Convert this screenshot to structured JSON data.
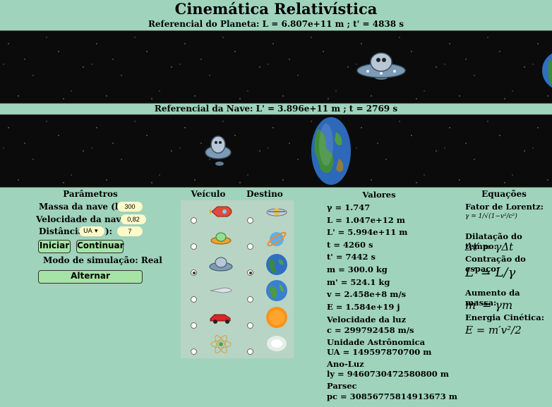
{
  "header": {
    "title": "Cinemática Relativística",
    "planet_frame": "Referencial do Planeta: L = 6.807e+11 m ; t' = 4838 s",
    "ship_frame": "Referencial da Nave: L' = 3.896e+11 m ; t = 2769 s"
  },
  "params": {
    "heading": "Parâmetros",
    "mass_label": "Massa da nave (kg):",
    "mass_value": "300",
    "speed_label": "Velocidade da nave (c):",
    "speed_value": "0,82",
    "distance_label_pre": "Distância (",
    "distance_unit": "UA",
    "distance_label_post": "):",
    "distance_value": "7",
    "start_button": "Iniciar",
    "continue_button": "Continuar",
    "mode_text": "Modo de simulação: Real",
    "toggle_button": "Alternar"
  },
  "selection": {
    "vehicle_heading": "Veículo",
    "destination_heading": "Destino",
    "vehicles": [
      "rocket-icon",
      "ufo-icon",
      "flying-saucer-icon",
      "spaceplane-icon",
      "race-car-icon",
      "atom-icon"
    ],
    "destinations": [
      "space-station-icon",
      "planet-icon",
      "earth-icon",
      "earth-globe-icon",
      "sun-icon",
      "nebula-icon"
    ],
    "selected_vehicle_index": 2,
    "selected_destination_index": 2
  },
  "values": {
    "heading": "Valores",
    "lines": [
      "γ = 1.747",
      "L = 1.047e+12 m",
      "L' = 5.994e+11 m",
      "t = 4260 s",
      "t' = 7442 s",
      "m = 300.0 kg",
      "m' = 524.1 kg",
      "v = 2.458e+8 m/s",
      "E = 1.584e+19 j"
    ],
    "light_title": "Velocidade da luz",
    "light_value": "c = 299792458 m/s",
    "au_title": "Unidade Astrônomica",
    "au_value": "UA = 149597870700 m",
    "ly_title": "Ano-Luz",
    "ly_value": "ly = 9460730472580800 m",
    "pc_title": "Parsec",
    "pc_value": "pc = 30856775814913673 m"
  },
  "equations": {
    "heading": "Equações",
    "lorentz_title": "Fator de Lorentz:",
    "lorentz_formula": "γ = 1/√(1−v²/c²)",
    "dilation_title": "Dilatação do tempo:",
    "dilation_formula": "Δt′ = γΔt",
    "contraction_title": "Contração do espaço:",
    "contraction_formula": "L′ = L/γ",
    "mass_title": "Aumento da massa:",
    "mass_formula": "m′ = γm",
    "energy_title": "Energia Cinética:",
    "energy_formula": "E = m′v²/2"
  }
}
